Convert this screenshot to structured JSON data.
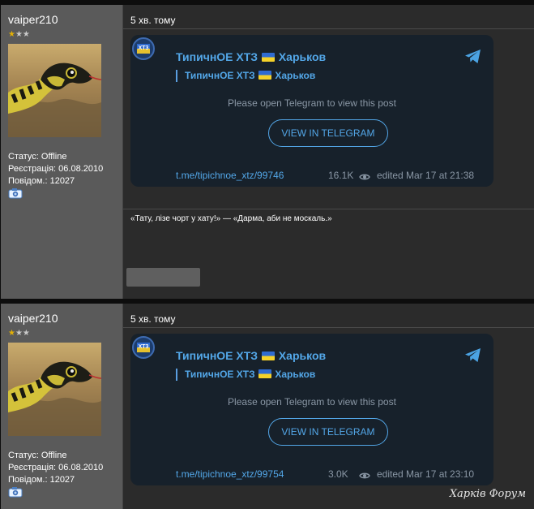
{
  "posts": [
    {
      "user": {
        "name": "vaiper210",
        "rating_filled": "★",
        "rating_empty": "★★",
        "status": "Статус: Offline",
        "registered": "Реєстрація: 06.08.2010",
        "posts_count": "Повідом.: 12027"
      },
      "time": "5 хв. тому",
      "telegram": {
        "title_text": "ТипичнОЕ ХТЗ",
        "title_city": "Харьков",
        "quote_text": "ТипичнОЕ ХТЗ",
        "quote_city": "Харьков",
        "notice": "Please open Telegram to view this post",
        "button": "VIEW IN TELEGRAM",
        "link": "t.me/tipichnoe_xtz/99746",
        "views": "16.1K",
        "edited": "edited  Mar 17 at 21:38"
      },
      "signature": "«Тату, лізе чорт у хату!» — «Дарма, аби не москаль.»"
    },
    {
      "user": {
        "name": "vaiper210",
        "rating_filled": "★",
        "rating_empty": "★★",
        "status": "Статус: Offline",
        "registered": "Реєстрація: 06.08.2010",
        "posts_count": "Повідом.: 12027"
      },
      "time": "5 хв. тому",
      "telegram": {
        "title_text": "ТипичнОЕ ХТЗ",
        "title_city": "Харьков",
        "quote_text": "ТипичнОЕ ХТЗ",
        "quote_city": "Харьков",
        "notice": "Please open Telegram to view this post",
        "button": "VIEW IN TELEGRAM",
        "link": "t.me/tipichnoe_xtz/99754",
        "views": "3.0K",
        "edited": "edited  Mar 17 at 23:10"
      }
    }
  ],
  "watermark": "Харків Форум",
  "icons": {
    "avatar": "snake-avatar-image",
    "camera": "camera-icon",
    "telegram": "telegram-plane-icon",
    "eye": "eye-icon",
    "flag": "ukraine-flag-icon"
  },
  "colors": {
    "accent": "#53a7e8",
    "card_bg": "#17212b",
    "sidebar_bg": "#5a5a5a",
    "content_bg": "#2b2b2b"
  }
}
